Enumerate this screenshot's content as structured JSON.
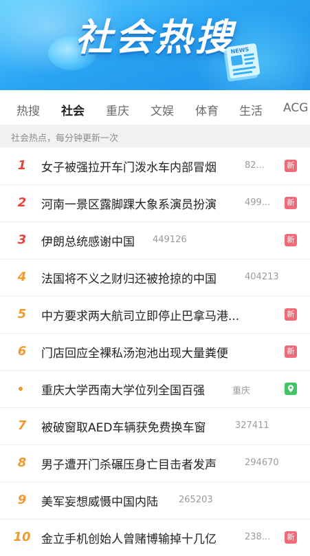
{
  "banner": {
    "title": "社会热搜",
    "news_label": "NEWS"
  },
  "tabs": [
    {
      "label": "热搜",
      "active": false
    },
    {
      "label": "社会",
      "active": true
    },
    {
      "label": "重庆",
      "active": false
    },
    {
      "label": "文娱",
      "active": false
    },
    {
      "label": "体育",
      "active": false
    },
    {
      "label": "生活",
      "active": false
    },
    {
      "label": "ACG",
      "active": false
    }
  ],
  "notice": "社会热点，每分钟更新一次",
  "items": [
    {
      "rank": "1",
      "title": "女子被强拉开车门泼水车内部冒烟",
      "count": "82...",
      "badge": "新"
    },
    {
      "rank": "2",
      "title": "河南一景区露脚踝大象系演员扮演",
      "count": "499...",
      "badge": "新"
    },
    {
      "rank": "3",
      "title": "伊朗总统感谢中国",
      "count": "449126",
      "badge": "新"
    },
    {
      "rank": "4",
      "title": "法国将不义之财归还被抢掠的中国",
      "count": "404213",
      "badge": ""
    },
    {
      "rank": "5",
      "title": "中方要求两大航司立即停止巴拿马港...",
      "count": "",
      "badge": "新"
    },
    {
      "rank": "6",
      "title": "门店回应全裸私汤泡池出现大量粪便",
      "count": "",
      "badge": "新"
    },
    {
      "rank": "",
      "title": "重庆大学西南大学位列全国百强",
      "count": "重庆",
      "badge": "location"
    },
    {
      "rank": "7",
      "title": "被破窗取AED车辆获免费换车窗",
      "count": "327411",
      "badge": ""
    },
    {
      "rank": "8",
      "title": "男子遭开门杀碾压身亡目击者发声",
      "count": "294670",
      "badge": ""
    },
    {
      "rank": "9",
      "title": "美军妄想威慑中国内陆",
      "count": "265203",
      "badge": ""
    },
    {
      "rank": "10",
      "title": "金立手机创始人曾赌博输掉十几亿",
      "count": "238...",
      "badge": "新"
    }
  ],
  "colors": {
    "rank_top": "#e8423b",
    "rank_rest": "#f29a2e",
    "badge_new": "#f16a7a",
    "badge_location": "#42c565",
    "banner": "#2aa4f4"
  }
}
